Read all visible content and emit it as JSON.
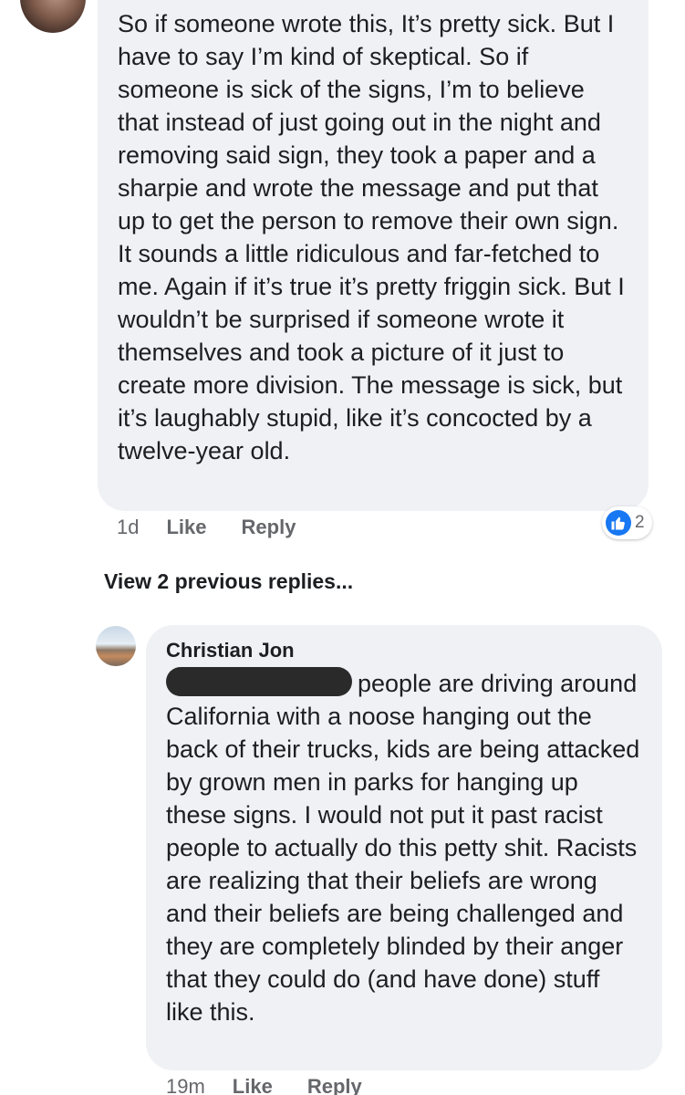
{
  "first_comment": {
    "text": "So if someone wrote this, It’s pretty sick. But I have to say I’m kind of skeptical. So if someone is sick of the signs, I’m to believe that instead of just going out in the night and removing said sign, they took a paper and a sharpie and wrote the message and put that up to get the person to remove their own sign. It sounds a little ridiculous and far-fetched to me. Again if it’s true it’s pretty friggin sick. But I wouldn’t be surprised if someone wrote it themselves and took a picture of it just to create more division. The message is sick, but it’s laughably stupid, like it’s concocted by a twelve-year old.",
    "time": "1d",
    "like_label": "Like",
    "reply_label": "Reply",
    "reaction_count": "2",
    "reaction_icon": "like-icon",
    "reaction_color": "#1877f2"
  },
  "view_previous_label": "View 2 previous replies...",
  "second_comment": {
    "author": "Christian Jon",
    "text": "people are driving around California with a noose hanging out the back of their trucks, kids are being attacked by grown men in parks for hanging up these signs. I would not put it past racist people to actually do this petty shit. Racists are realizing that their beliefs are wrong and their beliefs are being challenged and they are completely blinded by their anger that they could do (and have done) stuff like this.",
    "time": "19m",
    "like_label": "Like",
    "reply_label": "Reply"
  },
  "colors": {
    "bubble_bg": "#eff1f5",
    "text": "#1c1e21",
    "meta": "#65676b"
  }
}
